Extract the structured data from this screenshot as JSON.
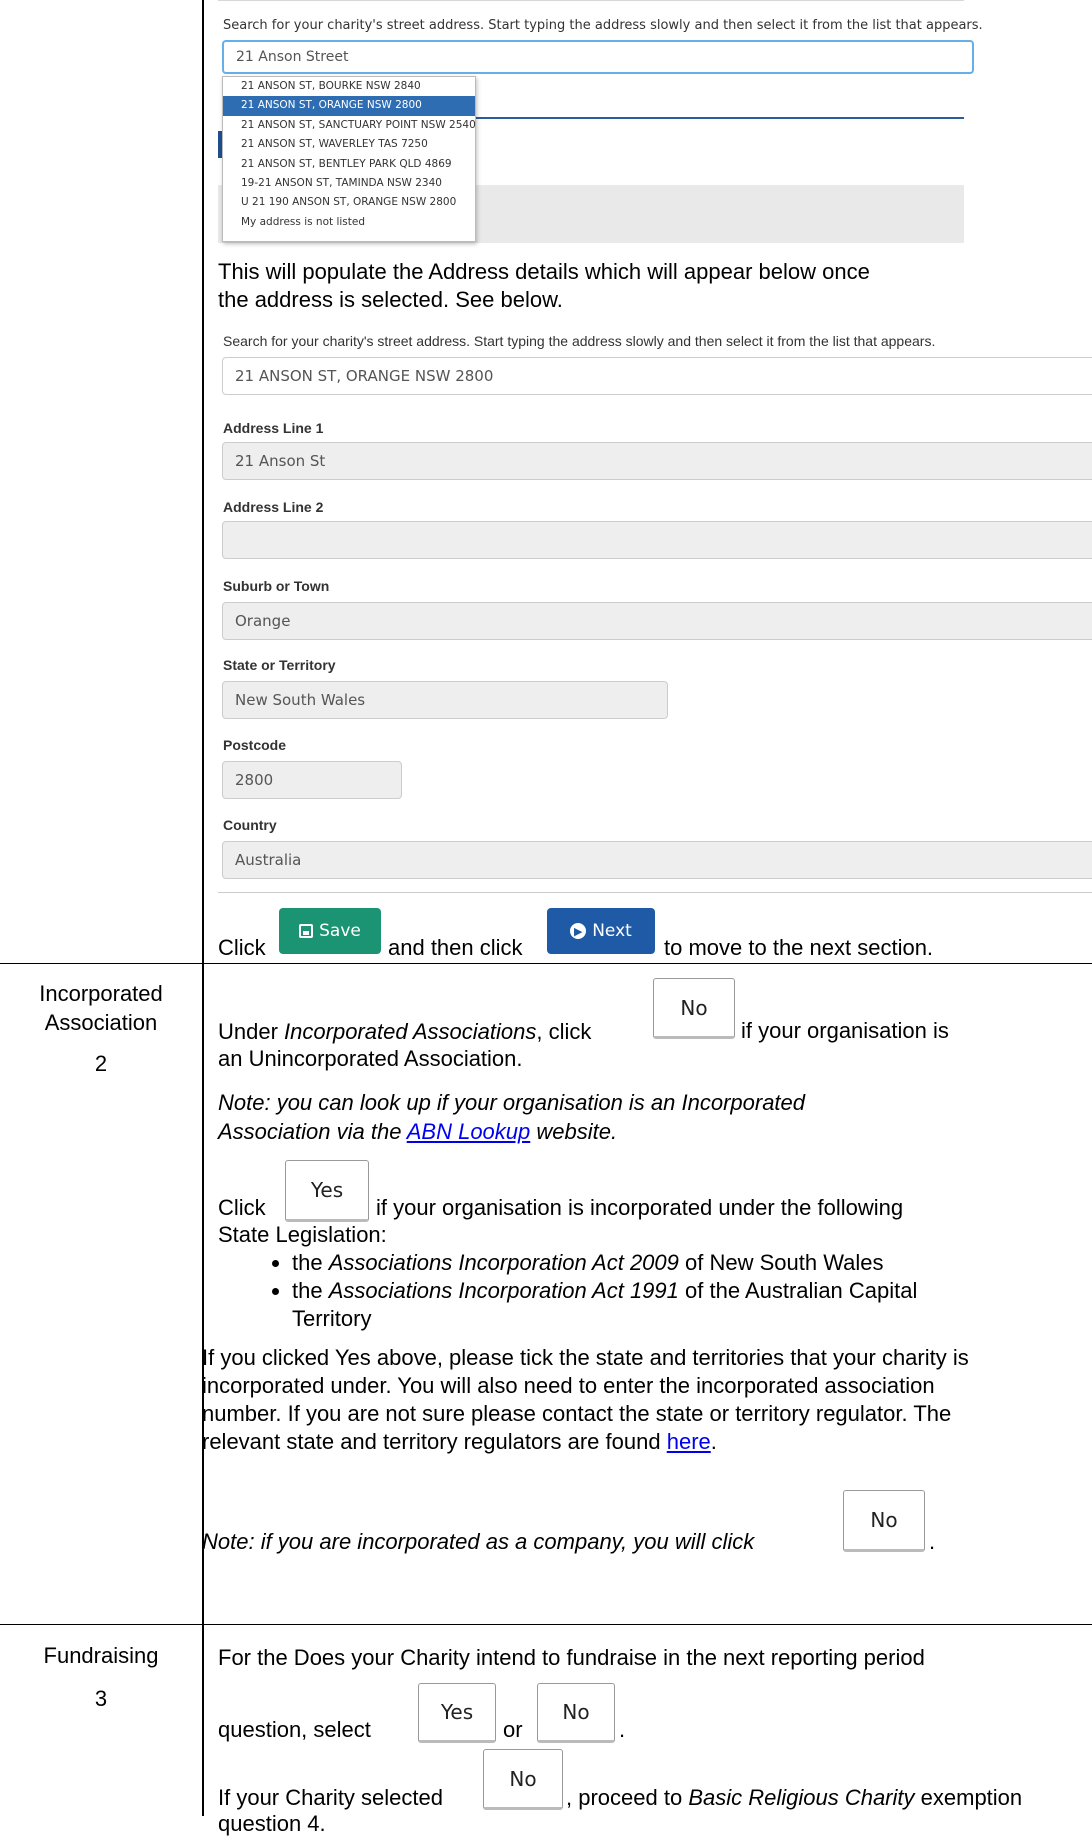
{
  "address_section": {
    "search_prompt": "Search for your charity's street address. Start typing the address slowly and then select it from the list that appears.",
    "search_typed": "21 Anson Street",
    "suggestions": [
      "21 ANSON ST, BOURKE NSW 2840",
      "21 ANSON ST, ORANGE NSW 2800",
      "21 ANSON ST, SANCTUARY POINT NSW 2540",
      "21 ANSON ST, WAVERLEY TAS 7250",
      "21 ANSON ST, BENTLEY PARK QLD 4869",
      "19-21 ANSON ST, TAMINDA NSW 2340",
      "U 21 190 ANSON ST, ORANGE NSW 2800",
      "My address is not listed"
    ],
    "selected_suggestion_index": 1,
    "populate_note_1": "This will populate the Address details which will appear below once",
    "populate_note_2": "the address is selected. See below.",
    "search_prompt_2": "Search for your charity's street address. Start typing the address slowly and then select it from the list that appears.",
    "search_selected": "21 ANSON ST, ORANGE NSW 2800",
    "fields": {
      "line1_label": "Address Line 1",
      "line1_value": "21 Anson St",
      "line2_label": "Address Line 2",
      "line2_value": "",
      "suburb_label": "Suburb or Town",
      "suburb_value": "Orange",
      "state_label": "State or Territory",
      "state_value": "New South Wales",
      "postcode_label": "Postcode",
      "postcode_value": "2800",
      "country_label": "Country",
      "country_value": "Australia"
    },
    "click_word": "Click",
    "save_label": "Save",
    "then_click": "and then click",
    "next_label": "Next",
    "move_next": "to move to the next section."
  },
  "incorporated": {
    "heading_1": "Incorporated",
    "heading_2": "Association",
    "number": "2",
    "under": "Under",
    "under_em": "Incorporated Associations",
    "click_comma": ", click",
    "no_label": "No",
    "if_unincorporated_1": "if your organisation is",
    "if_unincorporated_2": "an Unincorporated Association.",
    "note_1": "Note: you can look up if your organisation is an Incorporated",
    "note_2a": "Association via the",
    "note_link": "ABN Lookup",
    "note_2b": "website.",
    "click": "Click",
    "yes_label": "Yes",
    "if_incorporated": "if your organisation is incorporated under the following",
    "state_legislation": "State Legislation:",
    "bullet_1_pre": "the",
    "bullet_1_em": "Associations Incorporation Act 2009",
    "bullet_1_post": "of New South Wales",
    "bullet_2_pre": "the",
    "bullet_2_em": "Associations Incorporation Act 1991",
    "bullet_2_post": "of the Australian Capital",
    "bullet_2_wrap": "Territory",
    "tick_1": "If you clicked Yes above, please tick the state and territories that your charity is",
    "tick_2": "incorporated under. You will also need to enter the incorporated association",
    "tick_3": "number. If you are not sure please contact the state or territory regulator. The",
    "tick_4a": "relevant state and territory regulators are found",
    "tick_link": "here",
    "tick_4b": ".",
    "company_note": "Note: if you are incorporated as a company, you will click",
    "company_period": "."
  },
  "fundraising": {
    "heading": "Fundraising",
    "number": "3",
    "line_1": "For the Does your Charity intend to fundraise in the next reporting period",
    "question_select": "question, select",
    "yes_label": "Yes",
    "or": "or",
    "no_label": "No",
    "period": ".",
    "if_selected": "If your Charity selected",
    "proceed_a": ", proceed to",
    "proceed_em": "Basic Religious Charity",
    "proceed_b": "exemption",
    "question_4": "question 4."
  }
}
